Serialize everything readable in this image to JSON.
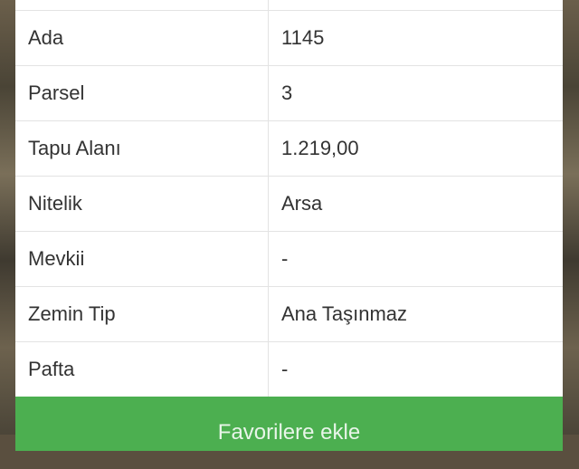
{
  "rows": [
    {
      "label": "Ada",
      "value": "1145"
    },
    {
      "label": "Parsel",
      "value": "3"
    },
    {
      "label": "Tapu Alanı",
      "value": "1.219,00"
    },
    {
      "label": "Nitelik",
      "value": "Arsa"
    },
    {
      "label": "Mevkii",
      "value": "-"
    },
    {
      "label": "Zemin Tip",
      "value": "Ana Taşınmaz"
    },
    {
      "label": "Pafta",
      "value": "-"
    }
  ],
  "button": {
    "label": "Favorilere ekle"
  },
  "colors": {
    "accent": "#4caf50",
    "border": "#e3e3e3",
    "text": "#333333"
  }
}
